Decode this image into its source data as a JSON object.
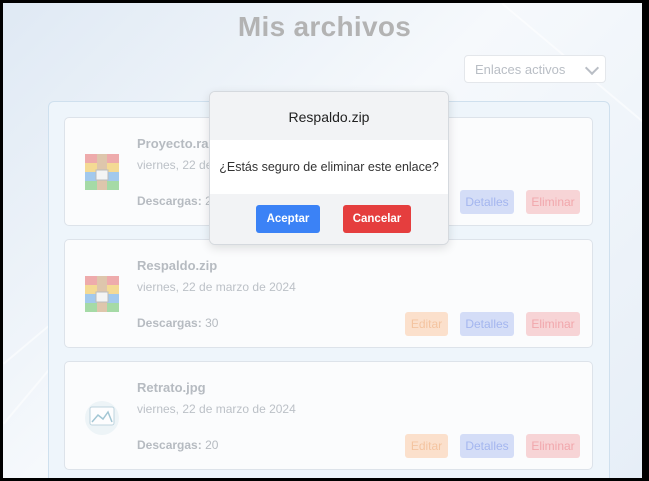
{
  "page": {
    "title": "Mis archivos"
  },
  "filter": {
    "selected": "Enlaces activos"
  },
  "files": [
    {
      "name": "Proyecto.rar",
      "date": "viernes, 22 de",
      "downloads_label": "Descargas:",
      "downloads": "20",
      "icon": "archive-icon"
    },
    {
      "name": "Respaldo.zip",
      "date": "viernes, 22 de marzo de 2024",
      "downloads_label": "Descargas:",
      "downloads": "30",
      "icon": "archive-icon"
    },
    {
      "name": "Retrato.jpg",
      "date": "viernes, 22 de marzo de 2024",
      "downloads_label": "Descargas:",
      "downloads": "20",
      "icon": "image-icon"
    }
  ],
  "actions": {
    "edit": "Editar",
    "details": "Detalles",
    "delete": "Eliminar"
  },
  "modal": {
    "title": "Respaldo.zip",
    "message": "¿Estás seguro de eliminar este enlace?",
    "confirm": "Aceptar",
    "cancel": "Cancelar"
  },
  "colors": {
    "confirm": "#3b82f6",
    "cancel": "#e53e3e",
    "edit": "#fbe0cc",
    "details": "#d4ddf7",
    "delete": "#f7d4d6"
  }
}
